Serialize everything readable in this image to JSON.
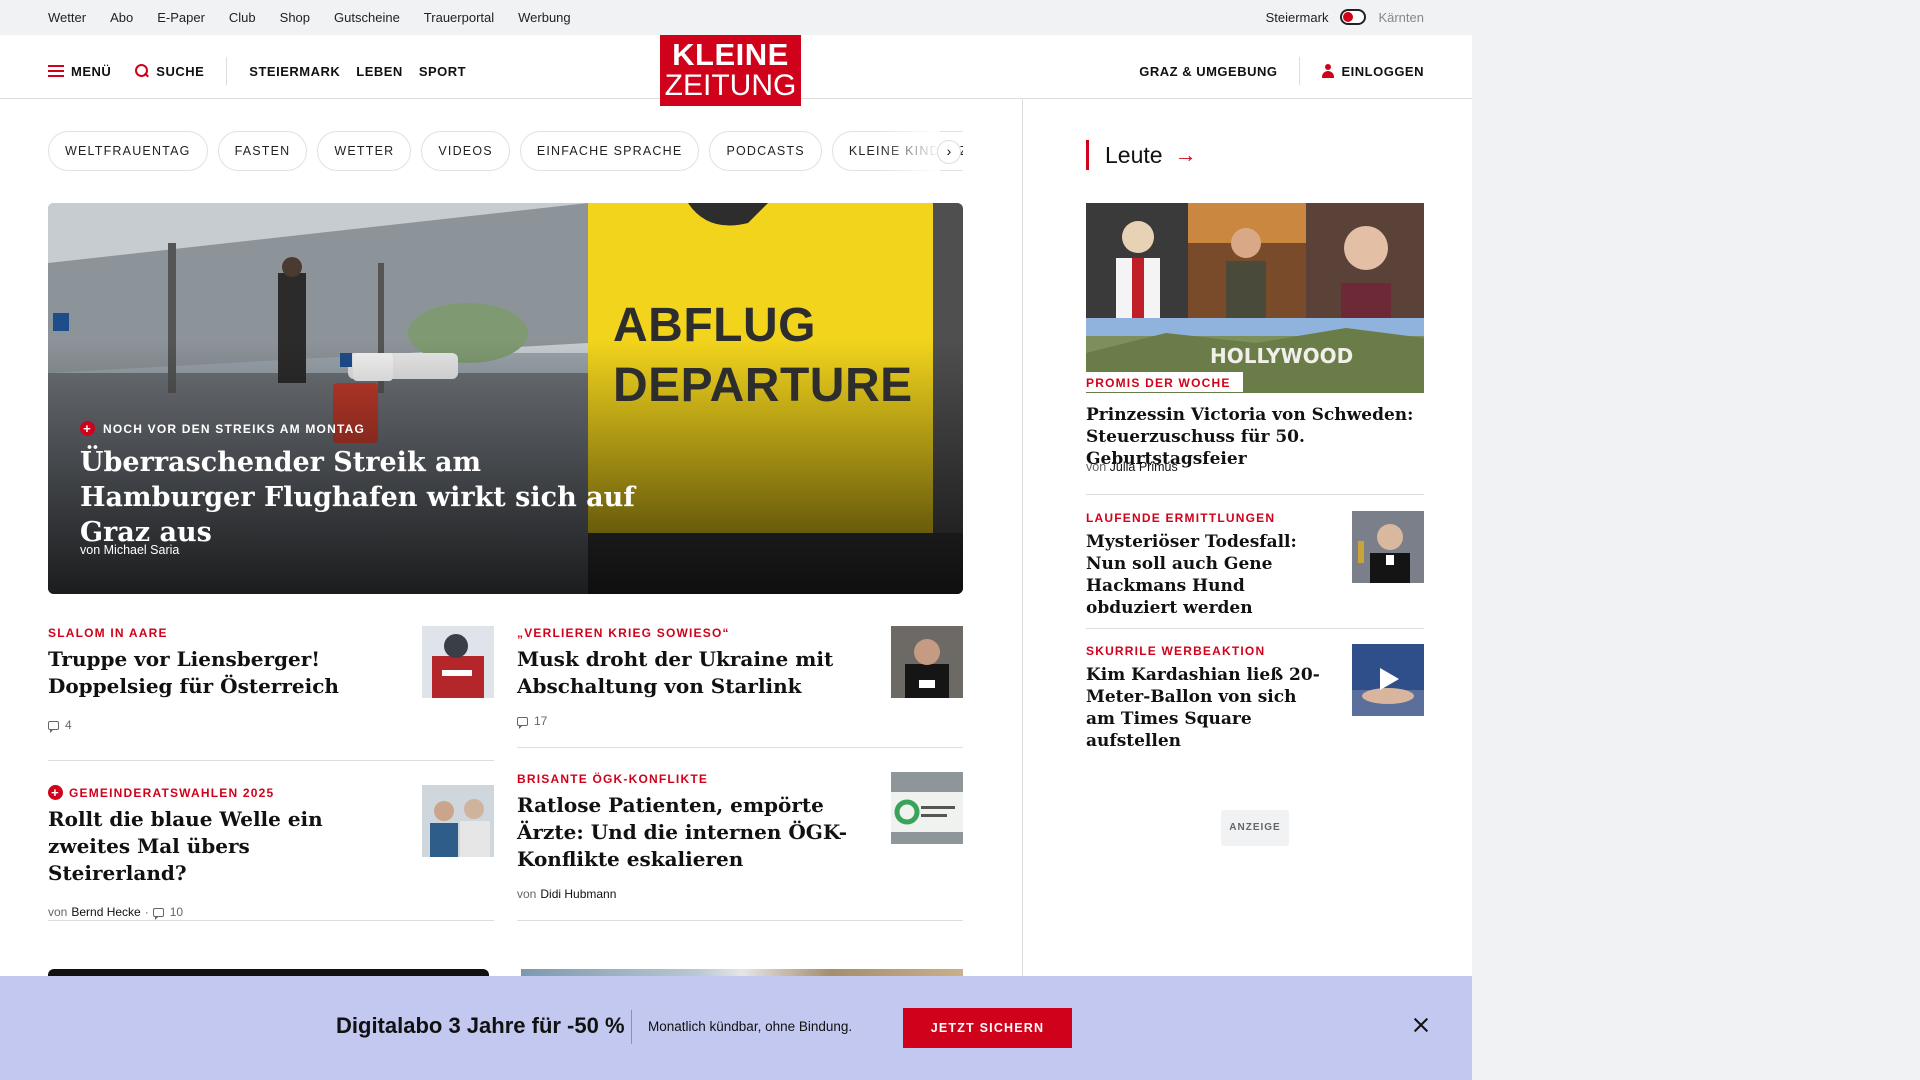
{
  "utility": {
    "links": [
      "Wetter",
      "Abo",
      "E-Paper",
      "Club",
      "Shop",
      "Gutscheine",
      "Trauerportal",
      "Werbung"
    ],
    "region_active": "Steiermark",
    "region_inactive": "Kärnten"
  },
  "header": {
    "menu_label": "MENÜ",
    "search_label": "SUCHE",
    "nav": [
      "STEIERMARK",
      "LEBEN",
      "SPORT"
    ],
    "logo_line1": "KLEINE",
    "logo_line2": "ZEITUNG",
    "local_label": "GRAZ & UMGEBUNG",
    "login_label": "EINLOGGEN"
  },
  "tags": [
    "WELTFRAUENTAG",
    "FASTEN",
    "WETTER",
    "VIDEOS",
    "EINFACHE SPRACHE",
    "PODCASTS",
    "KLEINE KINDERZEITUNG"
  ],
  "hero": {
    "sign_line1": "ABFLUG",
    "sign_line2": "DEPARTURE",
    "kicker": "NOCH VOR DEN STREIKS AM MONTAG",
    "title": "Überraschender Streik am Hamburger Flughafen wirkt sich auf Graz aus",
    "author_prefix": "von",
    "author": "Michael Saria"
  },
  "articles": [
    {
      "kicker": "SLALOM IN AARE",
      "title": "Truppe vor Liensberger! Doppelsieg für Österreich",
      "comments": "4"
    },
    {
      "kicker": "„VERLIEREN KRIEG SOWIESO“",
      "title": "Musk droht der Ukraine mit Abschaltung von Starlink",
      "comments": "17"
    },
    {
      "kicker": "GEMEINDERATSWAHLEN 2025",
      "title": "Rollt die blaue Welle ein zweites Mal übers Steirerland?",
      "author_prefix": "von",
      "author": "Bernd Hecke",
      "comments": "10"
    },
    {
      "kicker": "BRISANTE ÖGK-KONFLIKTE",
      "title": "Ratlose Patienten, empörte Ärzte: Und die internen ÖGK-Konflikte eskalieren",
      "author_prefix": "von",
      "author": "Didi Hubmann"
    }
  ],
  "sidebar": {
    "title": "Leute",
    "collage_text": "HOLLYWOOD",
    "featured": {
      "kicker": "PROMIS DER WOCHE",
      "title": "Prinzessin Victoria von Schweden: Steuerzuschuss für 50. Geburtstagsfeier",
      "author_prefix": "von",
      "author": "Julia Primus"
    },
    "items": [
      {
        "kicker": "LAUFENDE ERMITTLUNGEN",
        "title": "Mysteriöser Todesfall: Nun soll auch Gene Hackmans Hund obduziert werden"
      },
      {
        "kicker": "SKURRILE WERBEAKTION",
        "title": "Kim Kardashian ließ 20-Meter-Ballon von sich am Times Square aufstellen"
      }
    ],
    "ad_label": "ANZEIGE"
  },
  "promo": {
    "title": "Digitalabo 3 Jahre für -50 %",
    "subtitle": "Monatlich kündbar, ohne Bindung.",
    "button": "JETZT SICHERN"
  },
  "colors": {
    "brand_red": "#d0021b",
    "promo_bg": "#c2c8ef",
    "sign_yellow": "#f2d41c"
  }
}
